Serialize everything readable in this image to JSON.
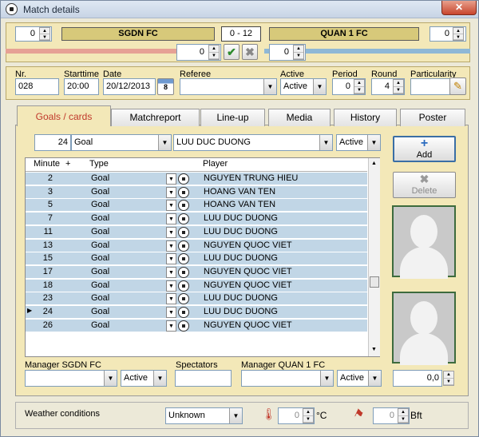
{
  "window": {
    "title": "Match details",
    "close_label": "✕"
  },
  "score_bar": {
    "home_count": "0",
    "home_team": "SGDN FC",
    "score": "0 - 12",
    "away_team": "QUAN 1 FC",
    "away_count": "0",
    "home_sub": "0",
    "away_sub": "0",
    "confirm_icon": "check-icon",
    "cancel_icon": "x-icon",
    "home_color": "#e6a195",
    "away_color": "#8fb8d6"
  },
  "info": {
    "nr_label": "Nr.",
    "nr": "028",
    "start_label": "Starttime",
    "start": "20:00",
    "date_label": "Date",
    "date": "20/12/2013",
    "cal_day": "8",
    "referee_label": "Referee",
    "referee": "",
    "active_label": "Active",
    "active": "Active",
    "period_label": "Period",
    "period": "0",
    "round_label": "Round",
    "round": "4",
    "part_label": "Particularity",
    "part": ""
  },
  "tabs": [
    "Goals / cards",
    "Matchreport",
    "Line-up",
    "Media",
    "History",
    "Poster"
  ],
  "editor": {
    "minute": "24",
    "type": "Goal",
    "player": "LUU DUC DUONG",
    "status": "Active"
  },
  "grid": {
    "headers": {
      "minute": "Minute",
      "plus": "+",
      "type": "Type",
      "player": "Player"
    },
    "rows": [
      {
        "minute": "2",
        "type": "Goal",
        "player": "NGUYEN TRUNG HIEU"
      },
      {
        "minute": "3",
        "type": "Goal",
        "player": "HOANG VAN TEN"
      },
      {
        "minute": "5",
        "type": "Goal",
        "player": "HOANG VAN TEN"
      },
      {
        "minute": "7",
        "type": "Goal",
        "player": "LUU DUC DUONG"
      },
      {
        "minute": "11",
        "type": "Goal",
        "player": "LUU DUC DUONG"
      },
      {
        "minute": "13",
        "type": "Goal",
        "player": "NGUYEN QUOC VIET"
      },
      {
        "minute": "15",
        "type": "Goal",
        "player": "LUU DUC DUONG"
      },
      {
        "minute": "17",
        "type": "Goal",
        "player": "NGUYEN QUOC VIET"
      },
      {
        "minute": "18",
        "type": "Goal",
        "player": "NGUYEN QUOC VIET"
      },
      {
        "minute": "23",
        "type": "Goal",
        "player": "LUU DUC DUONG"
      },
      {
        "minute": "24",
        "type": "Goal",
        "player": "LUU DUC DUONG"
      },
      {
        "minute": "26",
        "type": "Goal",
        "player": "NGUYEN QUOC VIET"
      }
    ],
    "current_row_marker": "▶"
  },
  "actions": {
    "add": "Add",
    "delete": "Delete",
    "rating": "0,0"
  },
  "bottom": {
    "mgr_home_label": "Manager SGDN FC",
    "mgr_home": "",
    "mgr_home_status": "Active",
    "spectators_label": "Spectators",
    "spectators": "",
    "mgr_away_label": "Manager QUAN 1 FC",
    "mgr_away": "",
    "mgr_away_status": "Active"
  },
  "weather": {
    "label": "Weather conditions",
    "condition": "Unknown",
    "temp": "0",
    "temp_unit": "°C",
    "wind": "0",
    "wind_unit": "Bft"
  }
}
